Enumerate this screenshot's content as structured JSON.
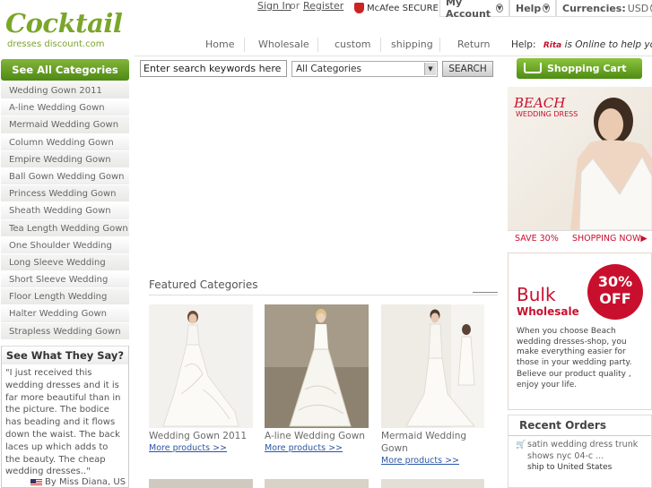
{
  "logo": {
    "main": "Cocktail",
    "sub": "dresses discount.com"
  },
  "top": {
    "signin": "Sign In",
    "or": "or",
    "register": "Register",
    "mcafee": "McAfee SECURE",
    "account": "My Account",
    "help": "Help",
    "currencies": "Currencies:",
    "currency_value": "USD"
  },
  "nav": [
    "Home",
    "Wholesale",
    "custom",
    "shipping",
    "Return"
  ],
  "help_line": {
    "prefix": "Help:",
    "name": "Rita",
    "suffix": "is Online to help you."
  },
  "sidebar": {
    "all_categories": "See All Categories",
    "items": [
      "Wedding Gown 2011",
      "A-line Wedding Gown",
      "Mermaid Wedding Gown",
      "Column Wedding Gown",
      "Empire Wedding Gown",
      "Ball Gown Wedding Gown",
      "Princess Wedding Gown",
      "Sheath Wedding Gown",
      "Tea Length Wedding Gown",
      "One Shoulder Wedding",
      "Long Sleeve Wedding",
      "Short Sleeve Wedding",
      "Floor Length Wedding",
      "Halter Wedding Gown",
      "Strapless Wedding Gown"
    ]
  },
  "search": {
    "value": "Enter search keywords here",
    "category": "All Categories",
    "button": "SEARCH"
  },
  "cart": {
    "label": "Shopping Cart"
  },
  "testimonial": {
    "title": "See What They Say?",
    "text": "\"I just received this wedding dresses and it is far more beautiful than in the picture. The bodice has beading and it flows down the waist. The back laces up which adds to the beauty. The cheap wedding dresses..\"",
    "by": "By Miss Diana, US"
  },
  "featured": {
    "title": "Featured Categories",
    "products": [
      {
        "name": "Wedding Gown 2011",
        "more": "More products >>"
      },
      {
        "name": "A-line Wedding Gown",
        "more": "More products >>"
      },
      {
        "name": "Mermaid Wedding Gown",
        "more": "More products >>"
      }
    ]
  },
  "banner_beach": {
    "title": "BEACH",
    "subtitle": "WEDDING DRESS",
    "save": "SAVE 30%",
    "shop": "SHOPPING NOW"
  },
  "banner_bulk": {
    "title": "Bulk",
    "subtitle": "Wholesale",
    "badge_pct": "30%",
    "badge_off": "OFF",
    "text1": "When you choose Beach wedding dresses-shop, you make everything easier for those in your wedding party.",
    "text2": "Believe our product quality , enjoy your life."
  },
  "recent_orders": {
    "title": "Recent Orders",
    "items": [
      {
        "product": "satin wedding dress trunk shows nyc 04-c ...",
        "ship": "ship to United States"
      }
    ]
  },
  "colors": {
    "brand_green": "#7aa62a",
    "link_blue": "#2a56a6",
    "red": "#c8102e"
  }
}
